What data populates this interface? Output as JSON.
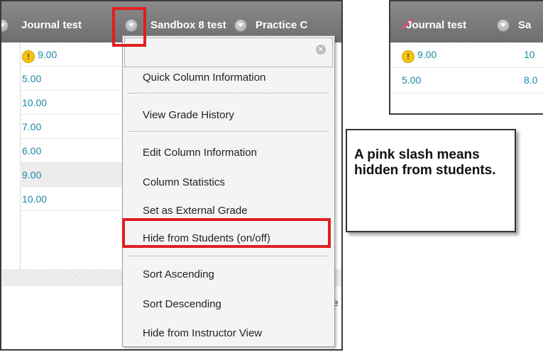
{
  "left_panel": {
    "headers": [
      "Journal test",
      "Sandbox 8 test",
      "Practice C"
    ],
    "rows": [
      {
        "value": "9.00",
        "warning": true
      },
      {
        "value": "5.00"
      },
      {
        "value": "10.00"
      },
      {
        "value": "7.00"
      },
      {
        "value": "6.00"
      },
      {
        "value": "9.00",
        "selected": true
      },
      {
        "value": "10.00"
      }
    ],
    "partial_text": "e"
  },
  "menu": {
    "close_glyph": "×",
    "items": [
      "Quick Column Information",
      "View Grade History",
      "Edit Column Information",
      "Column Statistics",
      "Set as External Grade",
      "Hide from Students (on/off)",
      "Sort Ascending",
      "Sort Descending",
      "Hide from Instructor View"
    ],
    "highlighted_item": "Hide from Students (on/off)"
  },
  "right_panel": {
    "headers": [
      "Journal test",
      "Sa"
    ],
    "rows": [
      {
        "col1": "9.00",
        "col2": "10",
        "warning": true
      },
      {
        "col1": "5.00",
        "col2": "8.0"
      }
    ],
    "hidden_indicator_color": "#e8468a"
  },
  "callout": {
    "text": "A pink slash means hidden from students."
  },
  "colors": {
    "header_bg": "#7c7c7c",
    "link_text": "#1a8aa5",
    "highlight_red": "#e01f1f"
  }
}
